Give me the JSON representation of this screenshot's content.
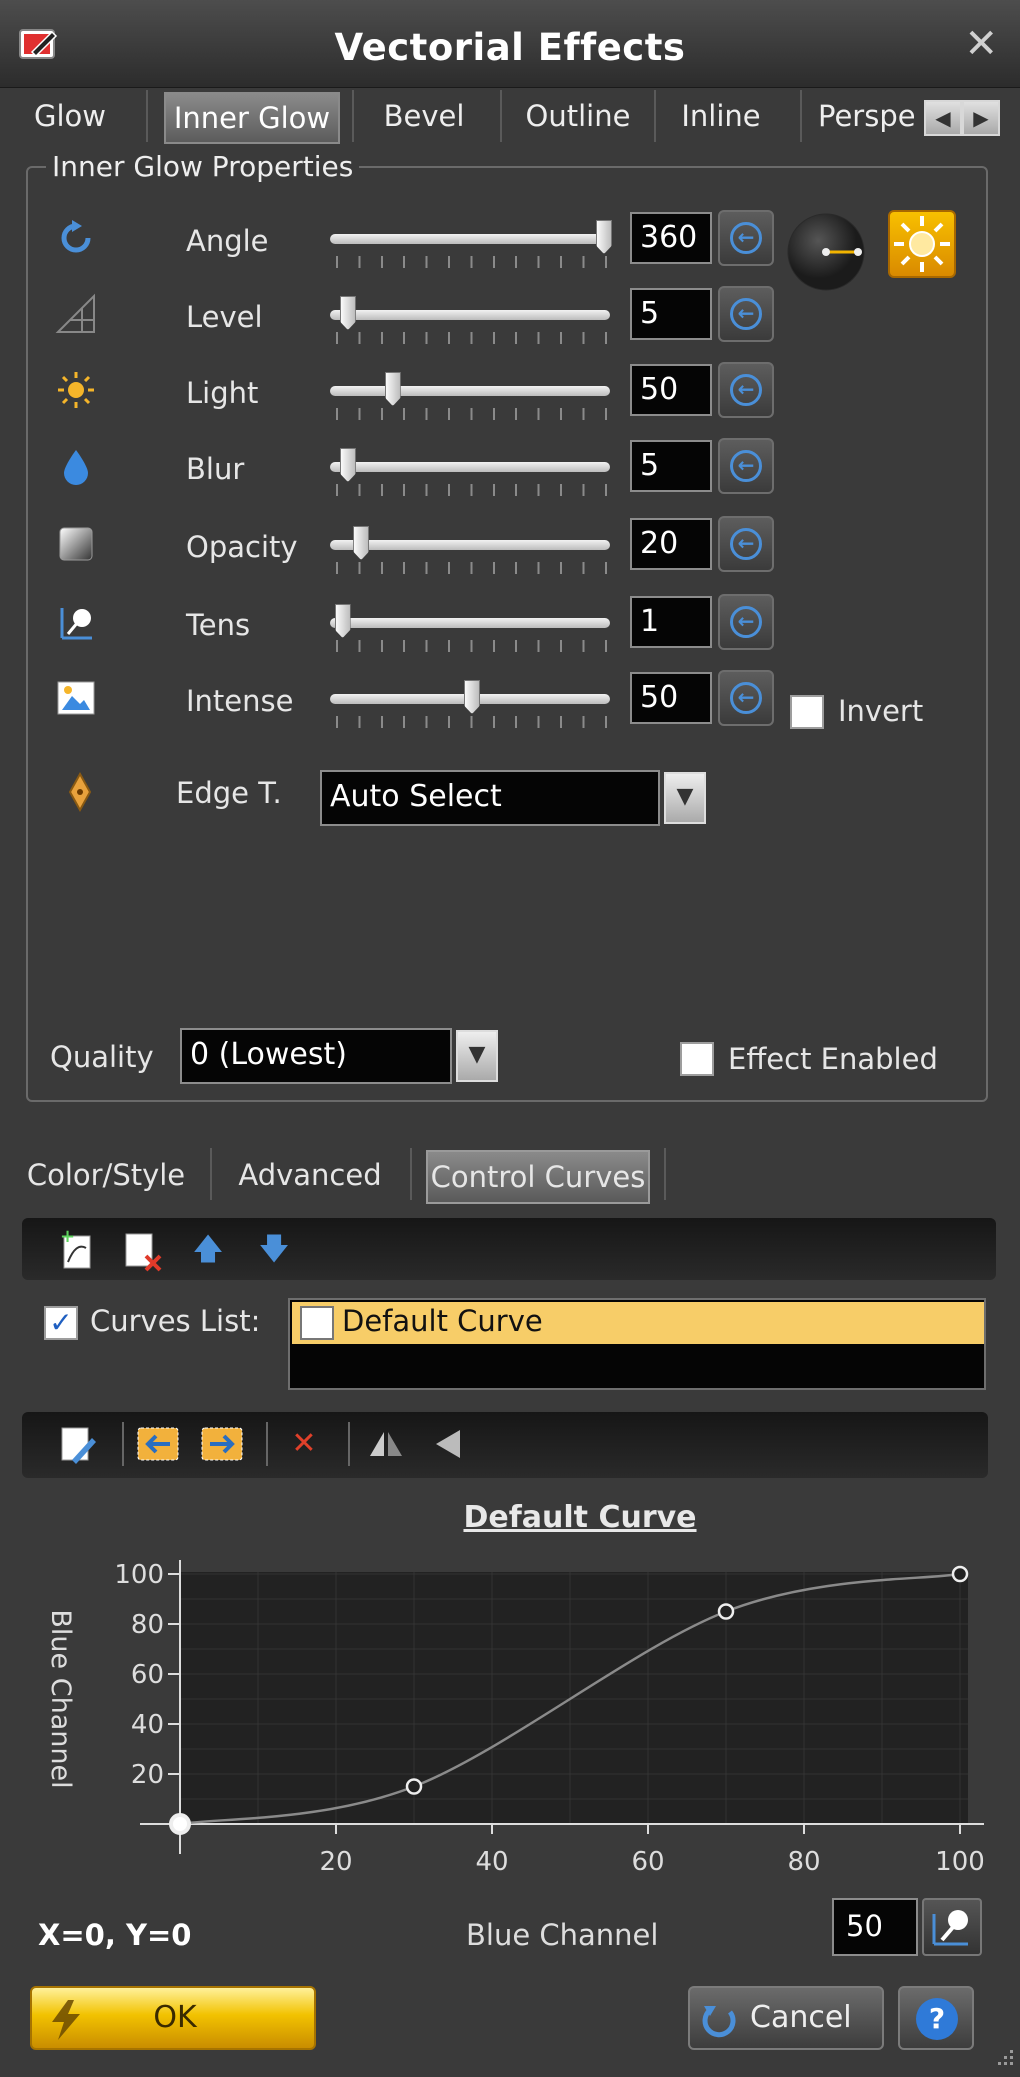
{
  "window": {
    "title": "Vectorial Effects"
  },
  "tabs": [
    "Glow",
    "Inner Glow",
    "Bevel",
    "Outline",
    "Inline",
    "Perspe"
  ],
  "active_tab": "Inner Glow",
  "group_title": "Inner Glow Properties",
  "properties": [
    {
      "label": "Angle",
      "value": "360",
      "fraction": 1.0,
      "icon": "rotate-icon"
    },
    {
      "label": "Level",
      "value": "5",
      "fraction": 0.03,
      "icon": "level-icon"
    },
    {
      "label": "Light",
      "value": "50",
      "fraction": 0.2,
      "icon": "sun-icon"
    },
    {
      "label": "Blur",
      "value": "5",
      "fraction": 0.03,
      "icon": "drop-icon"
    },
    {
      "label": "Opacity",
      "value": "20",
      "fraction": 0.08,
      "icon": "opacity-icon"
    },
    {
      "label": "Tens",
      "value": "1",
      "fraction": 0.01,
      "icon": "tension-icon"
    },
    {
      "label": "Intense",
      "value": "50",
      "fraction": 0.5,
      "icon": "intensity-icon"
    }
  ],
  "invert_label": "Invert",
  "edge": {
    "label": "Edge T.",
    "value": "Auto Select"
  },
  "quality": {
    "label": "Quality",
    "value": "0 (Lowest)"
  },
  "effect_enabled_label": "Effect Enabled",
  "bottom_tabs": [
    "Color/Style",
    "Advanced",
    "Control Curves"
  ],
  "active_bottom_tab": "Control Curves",
  "curves_list_label": "Curves List:",
  "curves": [
    "Default Curve"
  ],
  "chart_data": {
    "type": "line",
    "title": "Default Curve",
    "xlabel": "Blue Channel",
    "ylabel": "Blue Channel",
    "xlim": [
      0,
      100
    ],
    "ylim": [
      0,
      100
    ],
    "xticks": [
      20,
      40,
      60,
      80,
      100
    ],
    "yticks": [
      20,
      40,
      60,
      80,
      100
    ],
    "control_points": [
      [
        0,
        0
      ],
      [
        30,
        15
      ],
      [
        70,
        85
      ],
      [
        100,
        100
      ]
    ],
    "grid": true
  },
  "coords_text": "X=0, Y=0",
  "channel_label": "Blue Channel",
  "spin_value": "50",
  "buttons": {
    "ok": "OK",
    "cancel": "Cancel"
  }
}
